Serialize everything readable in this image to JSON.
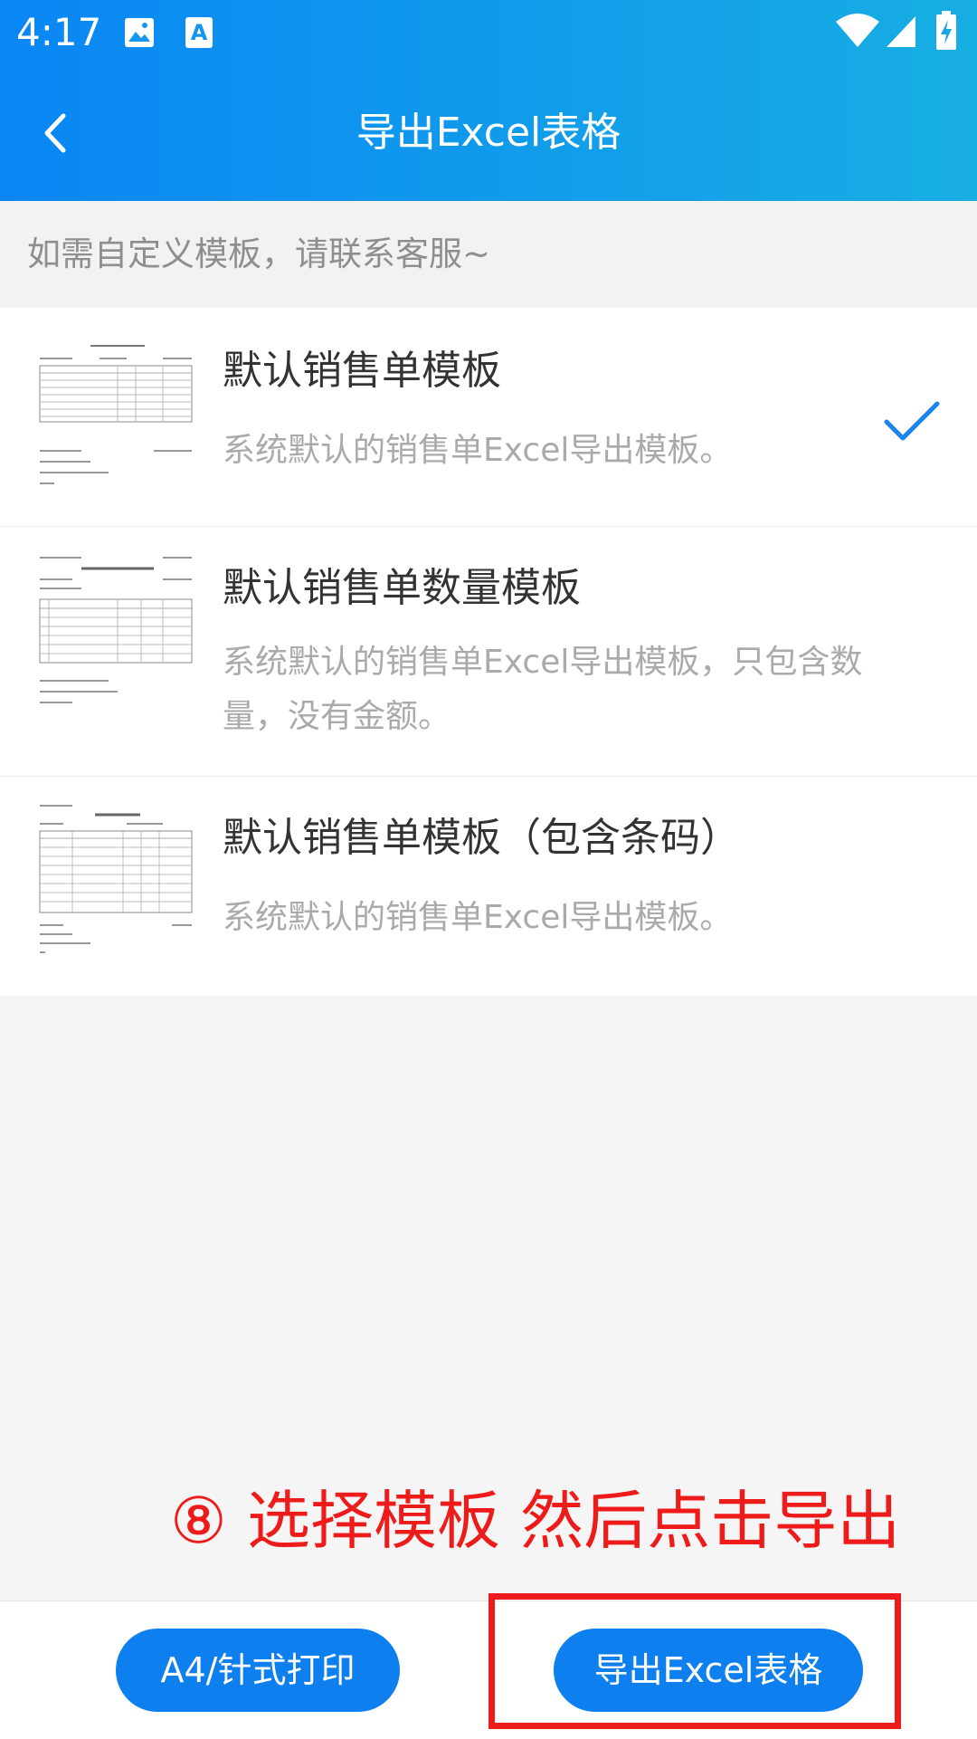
{
  "status_bar": {
    "time": "4:17",
    "icons": [
      "image-icon",
      "a-icon",
      "wifi-icon",
      "signal-icon",
      "battery-charging-icon"
    ]
  },
  "nav": {
    "back_icon": "chevron-left-icon",
    "title": "导出Excel表格"
  },
  "tip": "如需自定义模板，请联系客服~",
  "templates": [
    {
      "title": "默认销售单模板",
      "desc": "系统默认的销售单Excel导出模板。",
      "selected": true
    },
    {
      "title": "默认销售单数量模板",
      "desc": "系统默认的销售单Excel导出模板，只包含数量，没有金额。",
      "selected": false
    },
    {
      "title": "默认销售单模板（包含条码）",
      "desc": "系统默认的销售单Excel导出模板。",
      "selected": false
    }
  ],
  "annotation": "⑧ 选择模板 然后点击导出",
  "buttons": {
    "print": "A4/针式打印",
    "export": "导出Excel表格"
  },
  "colors": {
    "header_start": "#0a86f4",
    "header_end": "#17aee3",
    "button": "#0d7fef",
    "check": "#1a84ee",
    "annotation": "#ee1b1b"
  }
}
